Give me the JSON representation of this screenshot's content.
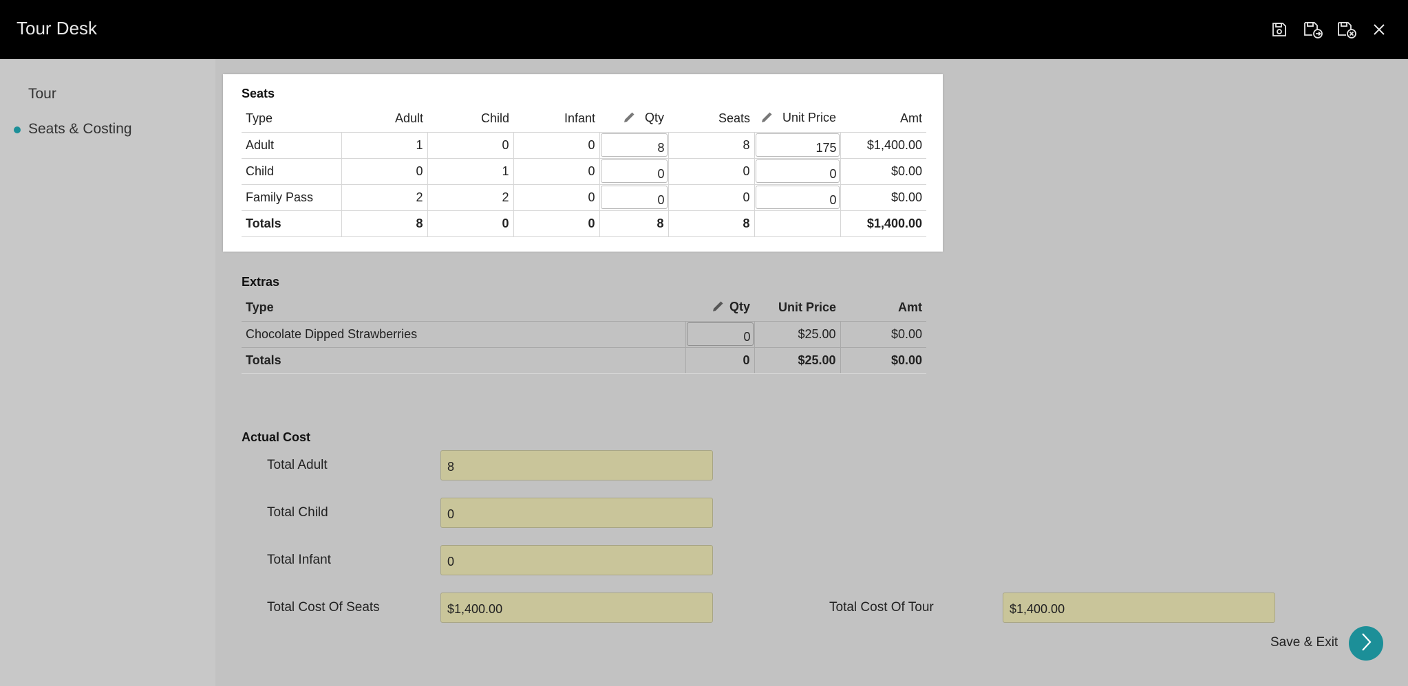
{
  "header": {
    "title": "Tour Desk",
    "icons": [
      "save-icon",
      "save-and-new-icon",
      "save-and-close-icon",
      "close-icon"
    ]
  },
  "sidebar": {
    "items": [
      {
        "label": "Tour",
        "active": false
      },
      {
        "label": "Seats & Costing",
        "active": true
      }
    ]
  },
  "seats": {
    "title": "Seats",
    "headers": {
      "type": "Type",
      "adult": "Adult",
      "child": "Child",
      "infant": "Infant",
      "qty": "Qty",
      "seats": "Seats",
      "unit_price": "Unit Price",
      "amt": "Amt"
    },
    "rows": [
      {
        "type": "Adult",
        "adult": "1",
        "child": "0",
        "infant": "0",
        "qty": "8",
        "seats": "8",
        "unit_price": "175",
        "amt": "$1,400.00"
      },
      {
        "type": "Child",
        "adult": "0",
        "child": "1",
        "infant": "0",
        "qty": "0",
        "seats": "0",
        "unit_price": "0",
        "amt": "$0.00"
      },
      {
        "type": "Family Pass",
        "adult": "2",
        "child": "2",
        "infant": "0",
        "qty": "0",
        "seats": "0",
        "unit_price": "0",
        "amt": "$0.00"
      }
    ],
    "totals": {
      "label": "Totals",
      "adult": "8",
      "child": "0",
      "infant": "0",
      "qty": "8",
      "seats": "8",
      "unit_price": "",
      "amt": "$1,400.00"
    }
  },
  "extras": {
    "title": "Extras",
    "headers": {
      "type": "Type",
      "qty": "Qty",
      "unit_price": "Unit Price",
      "amt": "Amt"
    },
    "rows": [
      {
        "type": "Chocolate Dipped Strawberries",
        "qty": "0",
        "unit_price": "$25.00",
        "amt": "$0.00"
      }
    ],
    "totals": {
      "label": "Totals",
      "qty": "0",
      "unit_price": "$25.00",
      "amt": "$0.00"
    }
  },
  "actual_cost": {
    "title": "Actual Cost",
    "total_adult_label": "Total Adult",
    "total_adult": "8",
    "total_child_label": "Total Child",
    "total_child": "0",
    "total_infant_label": "Total Infant",
    "total_infant": "0",
    "total_cost_seats_label": "Total Cost Of Seats",
    "total_cost_seats": "$1,400.00",
    "total_cost_tour_label": "Total Cost Of Tour",
    "total_cost_tour": "$1,400.00"
  },
  "footer": {
    "save_exit_label": "Save & Exit"
  },
  "colors": {
    "accent": "#1c8f98",
    "readonly_field": "#c9c59a",
    "header_bg": "#000000",
    "background": "#c2c2c2"
  }
}
